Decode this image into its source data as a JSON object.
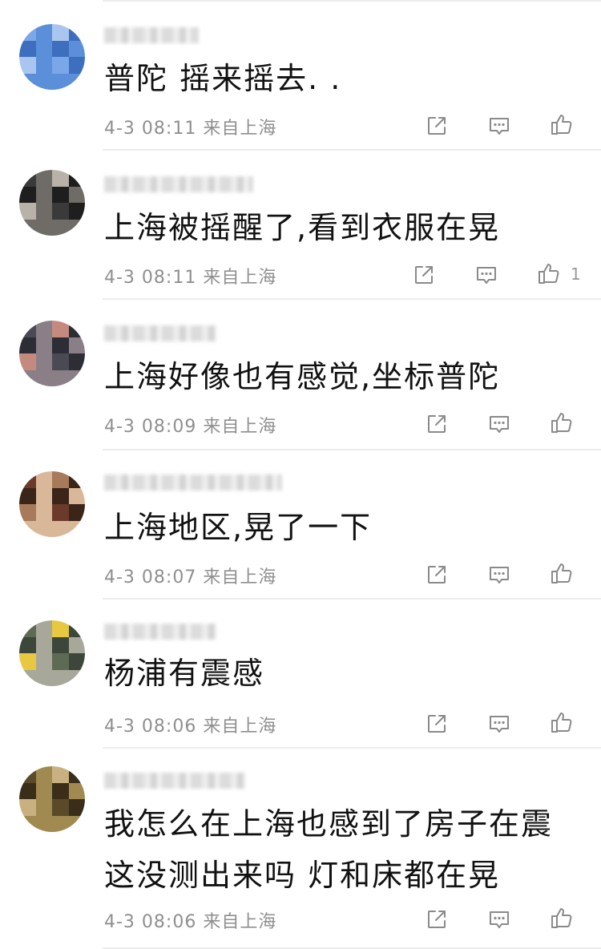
{
  "comments": [
    {
      "text": "普陀 摇来摇去. .",
      "time": "4-3 08:11",
      "source": "来自上海",
      "likes": "",
      "colors": [
        "#7aa7e8",
        "#5b8fd9",
        "#a9c6f0",
        "#3e6fbf"
      ]
    },
    {
      "text": "上海被摇醒了,看到衣服在晃",
      "time": "4-3 08:11",
      "source": "来自上海",
      "likes": "1",
      "colors": [
        "#3a3a3a",
        "#6f6b66",
        "#b8b2a8",
        "#1e1e1e"
      ]
    },
    {
      "text": "上海好像也有感觉,坐标普陀",
      "time": "4-3 08:09",
      "source": "来自上海",
      "likes": "",
      "colors": [
        "#4a4a55",
        "#8a7f86",
        "#c48a80",
        "#2d2d35"
      ]
    },
    {
      "text": "上海地区,晃了一下",
      "time": "4-3 08:07",
      "source": "来自上海",
      "likes": "",
      "colors": [
        "#6b3a2a",
        "#d9b89a",
        "#a67a5a",
        "#3b2418"
      ]
    },
    {
      "text": "杨浦有震感",
      "time": "4-3 08:06",
      "source": "来自上海",
      "likes": "",
      "colors": [
        "#5d6b55",
        "#a8a89a",
        "#e8c840",
        "#3d463a"
      ]
    },
    {
      "text": "我怎么在上海也感到了房子在震 这没测出来吗 灯和床都在晃",
      "time": "4-3 08:06",
      "source": "来自上海",
      "likes": "",
      "colors": [
        "#5a4a2a",
        "#a08a50",
        "#c8b080",
        "#3a2e1a"
      ]
    }
  ],
  "icons": {
    "share": "share-icon",
    "reply": "comment-icon",
    "like": "thumbs-up-icon"
  }
}
